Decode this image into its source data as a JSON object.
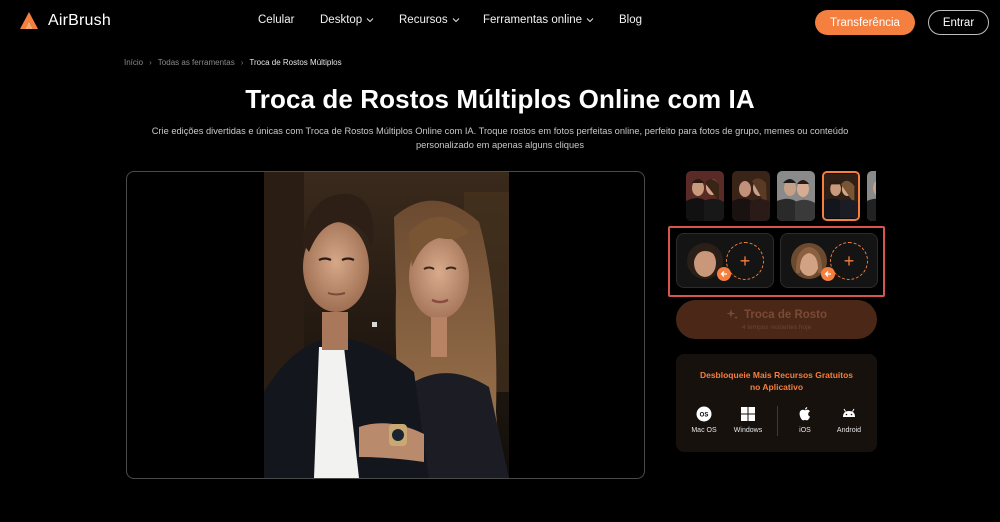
{
  "header": {
    "brand": "AirBrush",
    "nav": [
      {
        "label": "Celular",
        "dropdown": false
      },
      {
        "label": "Desktop",
        "dropdown": true
      },
      {
        "label": "Recursos",
        "dropdown": true
      },
      {
        "label": "Ferramentas online",
        "dropdown": true
      },
      {
        "label": "Blog",
        "dropdown": false
      }
    ],
    "transfer_button": "Transferência",
    "enter_button": "Entrar"
  },
  "breadcrumb": [
    "Início",
    "Todas as ferramentas",
    "Troca de Rostos Múltiplos"
  ],
  "page": {
    "title": "Troca de Rostos Múltiplos Online com IA",
    "subtitle": "Crie edições divertidas e únicas com Troca de Rostos Múltiplos Online com IA. Troque rostos em fotos perfeitas online, perfeito para fotos de grupo, memes ou conteúdo personalizado em apenas alguns cliques"
  },
  "face_swap": {
    "add_symbol": "+",
    "button_label": "Troca de Rosto",
    "button_subtext": "4 tempos restantes hoje"
  },
  "promo": {
    "title_line1": "Desbloqueie Mais Recursos Gratuitos",
    "title_line2": "no Aplicativo",
    "platforms": [
      {
        "label": "Mac OS",
        "icon": "macos-icon"
      },
      {
        "label": "Windows",
        "icon": "windows-icon"
      },
      {
        "label": "iOS",
        "icon": "apple-icon"
      },
      {
        "label": "Android",
        "icon": "android-icon"
      }
    ]
  },
  "colors": {
    "accent": "#f47f3e",
    "background": "#000000",
    "highlight": "#d9544f"
  }
}
